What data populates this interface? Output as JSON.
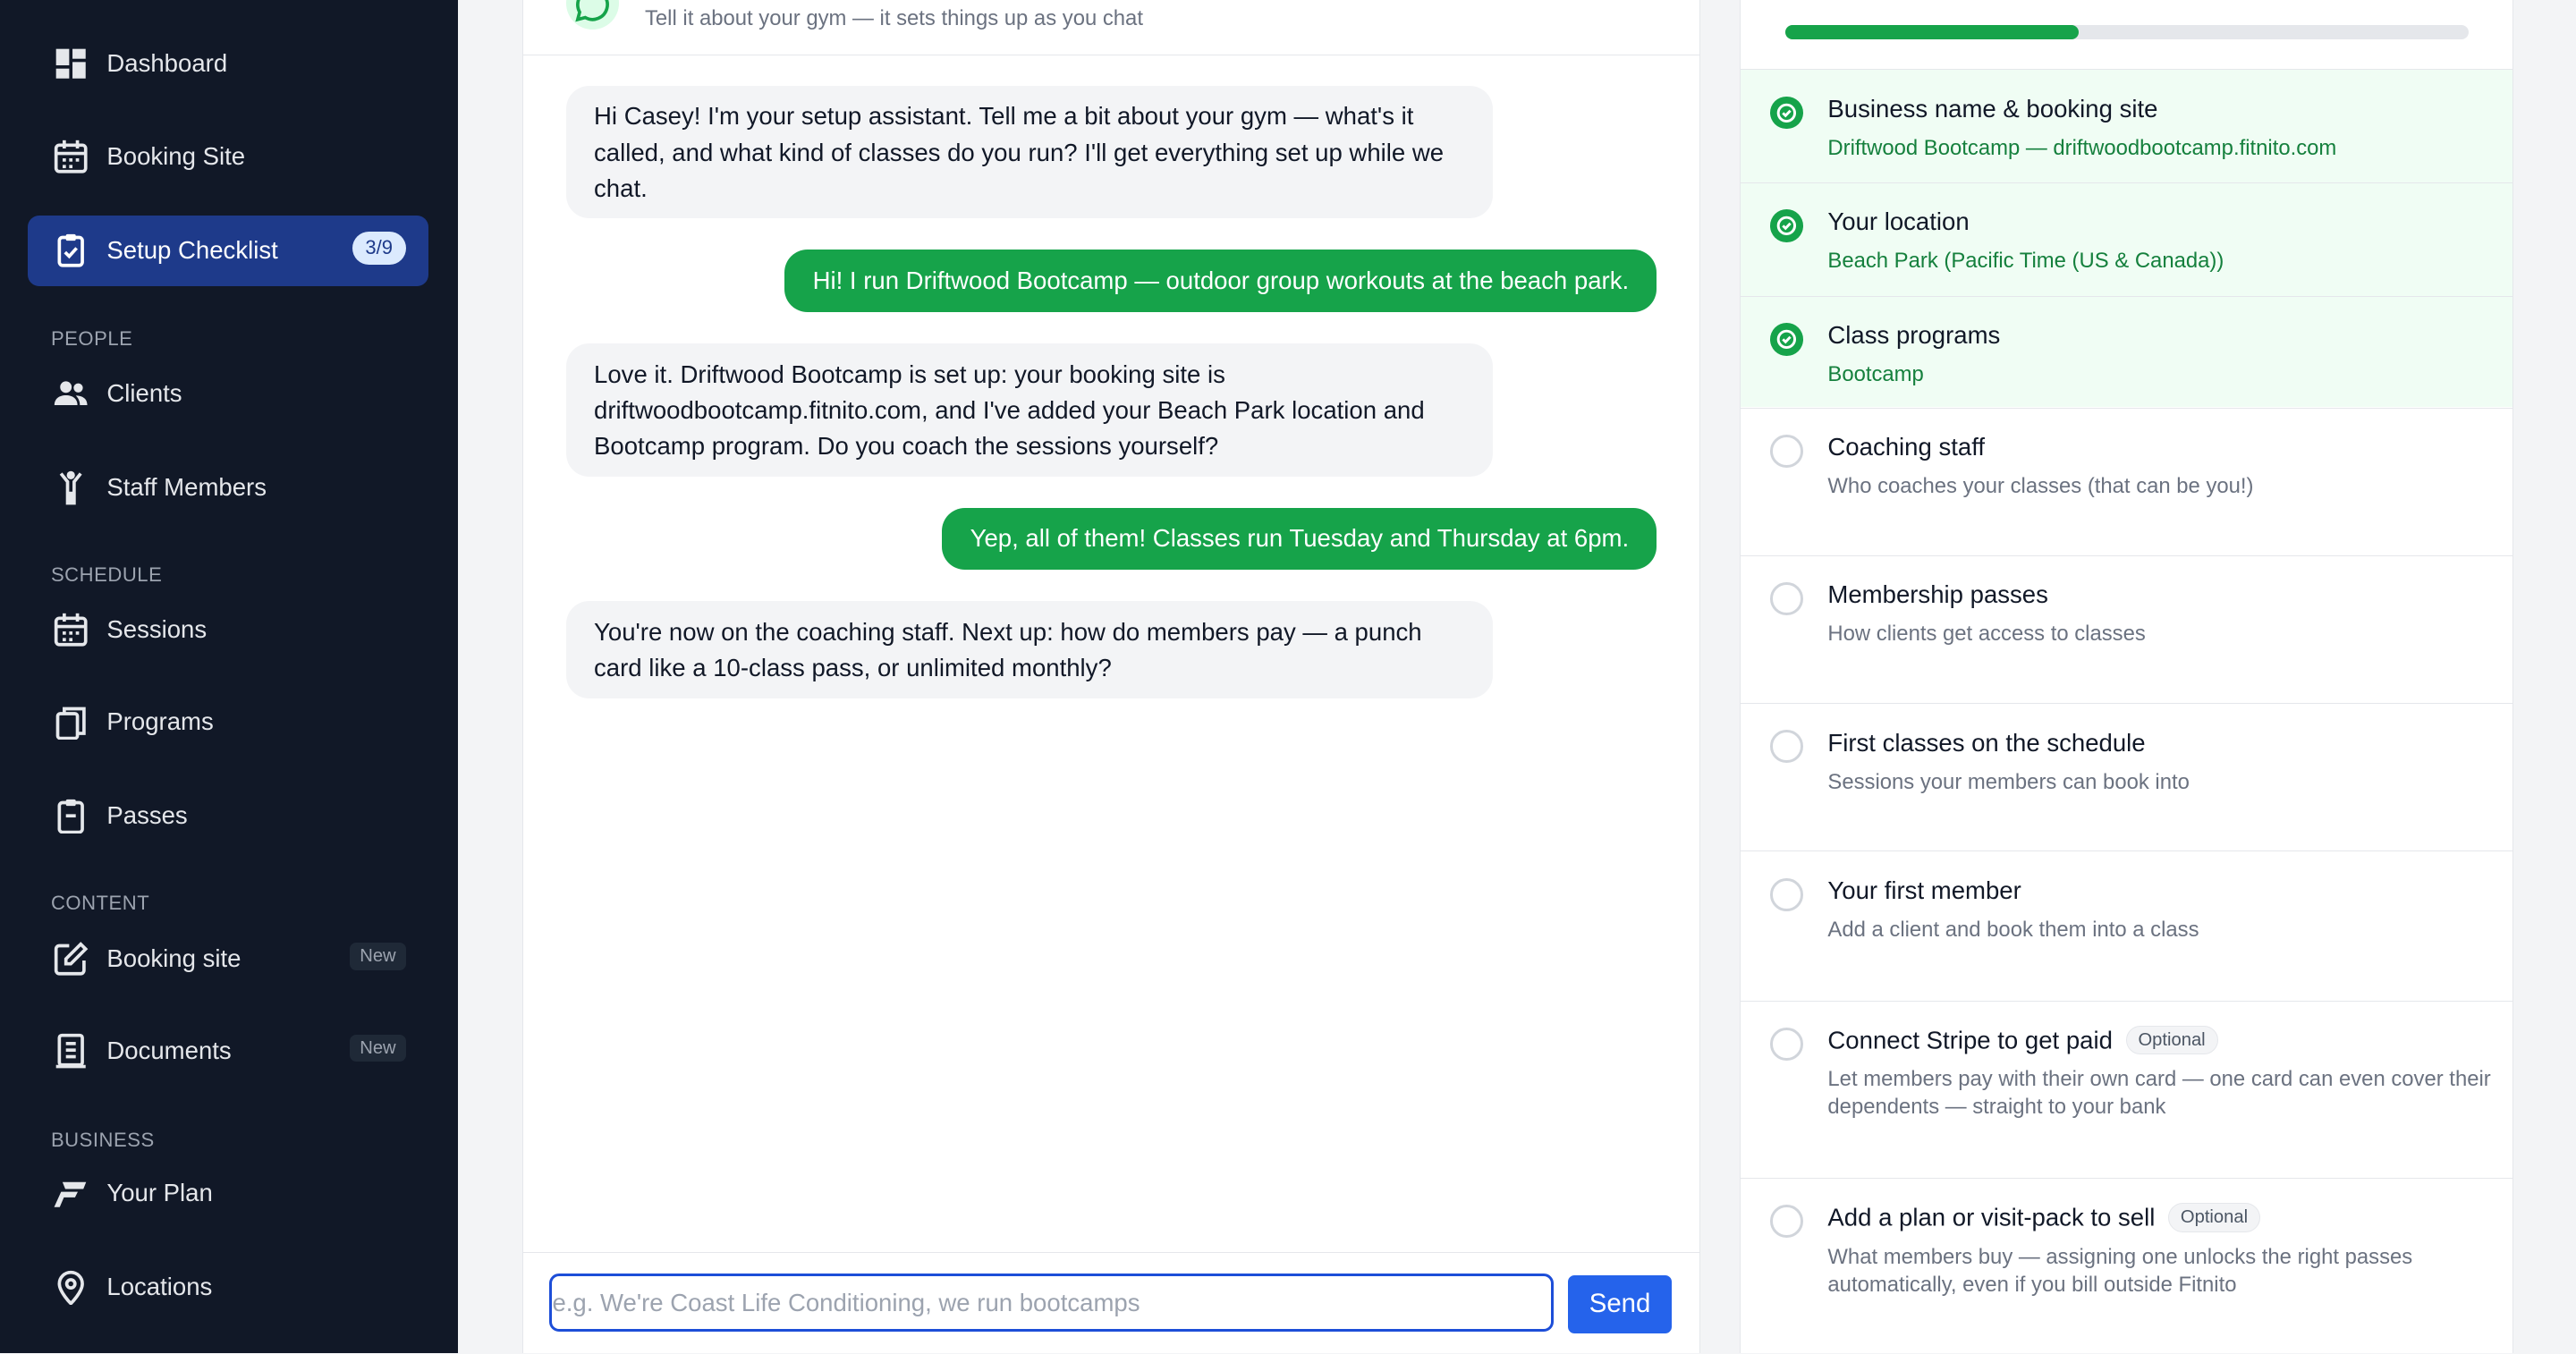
{
  "sidebar": {
    "items": [
      {
        "label": "Dashboard",
        "icon": "dashboard-icon"
      },
      {
        "label": "Booking Site",
        "icon": "calendar-icon"
      },
      {
        "label": "Setup Checklist",
        "icon": "clipboard-check-icon",
        "badge": "3/9",
        "active": true
      },
      {
        "label": "Clients",
        "icon": "users-icon"
      },
      {
        "label": "Staff Members",
        "icon": "person-icon"
      },
      {
        "label": "Sessions",
        "icon": "calendar-icon"
      },
      {
        "label": "Programs",
        "icon": "copy-icon"
      },
      {
        "label": "Passes",
        "icon": "clipboard-icon"
      },
      {
        "label": "Booking site",
        "icon": "edit-icon",
        "badge": "New"
      },
      {
        "label": "Documents",
        "icon": "document-icon",
        "badge": "New"
      },
      {
        "label": "Your Plan",
        "icon": "brand-icon"
      },
      {
        "label": "Locations",
        "icon": "map-pin-icon"
      }
    ],
    "sections": {
      "people": "PEOPLE",
      "schedule": "SCHEDULE",
      "content": "CONTENT",
      "business": "BUSINESS"
    }
  },
  "chat": {
    "subtitle": "Tell it about your gym — it sets things up as you chat",
    "messages": [
      {
        "role": "bot",
        "text": "Hi Casey! I'm your setup assistant. Tell me a bit about your gym — what's it called, and what kind of classes do you run? I'll get everything set up while we chat."
      },
      {
        "role": "user",
        "text": "Hi! I run Driftwood Bootcamp — outdoor group workouts at the beach park."
      },
      {
        "role": "bot",
        "text": "Love it. Driftwood Bootcamp is set up: your booking site is driftwoodbootcamp.fitnito.com, and I've added your Beach Park location and Bootcamp program. Do you coach the sessions yourself?"
      },
      {
        "role": "user",
        "text": "Yep, all of them! Classes run Tuesday and Thursday at 6pm."
      },
      {
        "role": "bot",
        "text": "You're now on the coaching staff. Next up: how do members pay — a punch card like a 10-class pass, or unlimited monthly?"
      }
    ],
    "input_placeholder": "e.g. We're Coast Life Conditioning, we run bootcamps",
    "input_value": "",
    "send_label": "Send"
  },
  "checklist": {
    "progress": 0.43,
    "colors": {
      "done": "#16a34a",
      "pending": "#d1d5db",
      "accent": "#2563eb"
    },
    "items": [
      {
        "title": "Business name & booking site",
        "subtitle": "Driftwood Bootcamp — driftwoodbootcamp.fitnito.com",
        "done": true
      },
      {
        "title": "Your location",
        "subtitle": "Beach Park (Pacific Time (US & Canada))",
        "done": true
      },
      {
        "title": "Class programs",
        "subtitle": "Bootcamp",
        "done": true
      },
      {
        "title": "Coaching staff",
        "subtitle": "Who coaches your classes (that can be you!)",
        "done": false
      },
      {
        "title": "Membership passes",
        "subtitle": "How clients get access to classes",
        "done": false
      },
      {
        "title": "First classes on the schedule",
        "subtitle": "Sessions your members can book into",
        "done": false
      },
      {
        "title": "Your first member",
        "subtitle": "Add a client and book them into a class",
        "done": false
      },
      {
        "title": "Connect Stripe to get paid",
        "badge": "Optional",
        "subtitle": "Let members pay with their own card — one card can even cover their dependents — straight to your bank",
        "done": false
      },
      {
        "title": "Add a plan or visit-pack to sell",
        "badge": "Optional",
        "subtitle": "What members buy — assigning one unlocks the right passes automatically, even if you bill outside Fitnito",
        "done": false
      }
    ]
  }
}
